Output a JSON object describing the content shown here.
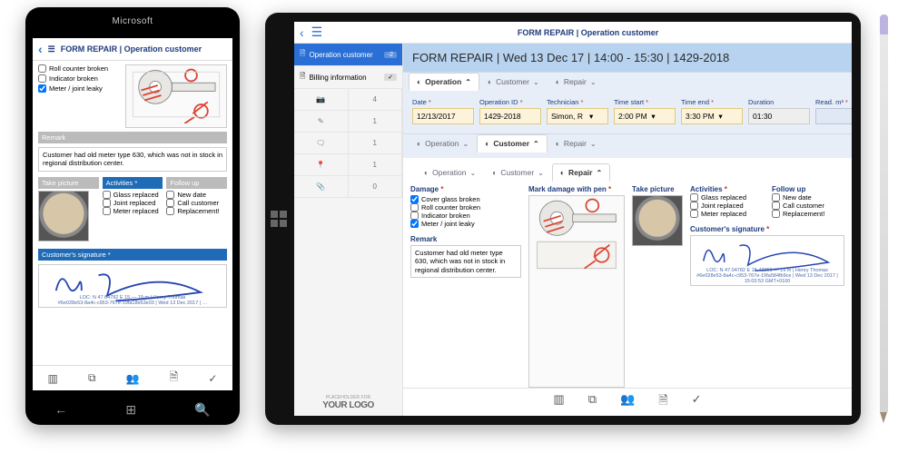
{
  "phone": {
    "brand": "Microsoft",
    "header_title": "FORM REPAIR | Operation customer",
    "damage_checks": [
      {
        "label": "Roll counter broken",
        "checked": false
      },
      {
        "label": "Indicator broken",
        "checked": false
      },
      {
        "label": "Meter / joint leaky",
        "checked": true
      }
    ],
    "remark_hd": "Remark",
    "remark_text": "Customer had old meter type 630, which was not in stock in regional distribution center.",
    "take_picture_hd": "Take picture",
    "activities_hd": "Activities *",
    "followup_hd": "Follow up",
    "activities": [
      {
        "label": "Glass replaced"
      },
      {
        "label": "Joint replaced"
      },
      {
        "label": "Meter replaced"
      }
    ],
    "followups": [
      {
        "label": "New date"
      },
      {
        "label": "Call customer"
      },
      {
        "label": "Replacement!"
      }
    ],
    "signature_hd": "Customer's signature *",
    "signature_meta1": "LOC: N 47.04782  E 15.—  19 m | Henry Thomas",
    "signature_meta2": "#6e028e53-8a4c-c953-767e-19fa18e63e03 | Wed 13 Dec 2017 | …"
  },
  "tablet": {
    "app_title": "FORM REPAIR | Operation customer",
    "sidebar": {
      "tabs": [
        {
          "label": "Operation customer",
          "badge": "-2",
          "active": true,
          "icon": "doc"
        },
        {
          "label": "Billing information",
          "badge": "✓",
          "active": false,
          "icon": "doc"
        }
      ],
      "counts": {
        "camera": "4",
        "pen": "1",
        "post": "1",
        "pin": "1",
        "clip": "0"
      },
      "logo_placeholder": "PLACEHOLDER FOR",
      "logo_text": "YOUR LOGO"
    },
    "main_title": "FORM REPAIR | Wed 13 Dec 17 | 14:00 - 15:30 | 1429-2018",
    "section_tabs": [
      "Operation",
      "Customer",
      "Repair"
    ],
    "op": {
      "fields": [
        {
          "key": "date",
          "label": "Date",
          "value": "12/13/2017",
          "req": true,
          "cls": ""
        },
        {
          "key": "opid",
          "label": "Operation ID",
          "value": "1429-2018",
          "req": true,
          "cls": ""
        },
        {
          "key": "tech",
          "label": "Technician",
          "value": "Simon, R   ▾",
          "req": true,
          "cls": ""
        },
        {
          "key": "tstart",
          "label": "Time start",
          "value": "2:00 PM  ▾",
          "req": true,
          "cls": ""
        },
        {
          "key": "tend",
          "label": "Time end",
          "value": "3:30 PM  ▾",
          "req": true,
          "cls": ""
        },
        {
          "key": "dur",
          "label": "Duration",
          "value": "01:30",
          "req": false,
          "cls": "grey"
        },
        {
          "key": "read",
          "label": "Read. m³",
          "value": "",
          "req": true,
          "cls": "blue"
        }
      ]
    },
    "repair": {
      "damage_hd": "Damage",
      "damage_checks": [
        {
          "label": "Cover glass broken",
          "checked": true
        },
        {
          "label": "Roll counter broken",
          "checked": false
        },
        {
          "label": "Indicator broken",
          "checked": false
        },
        {
          "label": "Meter / joint leaky",
          "checked": true
        }
      ],
      "mark_hd": "Mark damage with pen",
      "remark_hd": "Remark",
      "remark_text": "Customer had old meter type 630, which was not in stock in regional distribution center.",
      "take_picture_hd": "Take picture",
      "activities_hd": "Activities",
      "followup_hd": "Follow up",
      "activities": [
        {
          "label": "Glass replaced"
        },
        {
          "label": "Joint replaced"
        },
        {
          "label": "Meter replaced"
        }
      ],
      "followups": [
        {
          "label": "New date"
        },
        {
          "label": "Call customer"
        },
        {
          "label": "Replacement!"
        }
      ],
      "signature_hd": "Customer's signature",
      "signature_meta1": "LOC: N 47.04782  E 15.42351 —  19 m | Henry Thomas",
      "signature_meta2": "#6e028e53-8a4c-c953-767e-19fa584fb9ce | Wed 13 Dec 2017 | 15:03:53 GMT+0100"
    }
  }
}
